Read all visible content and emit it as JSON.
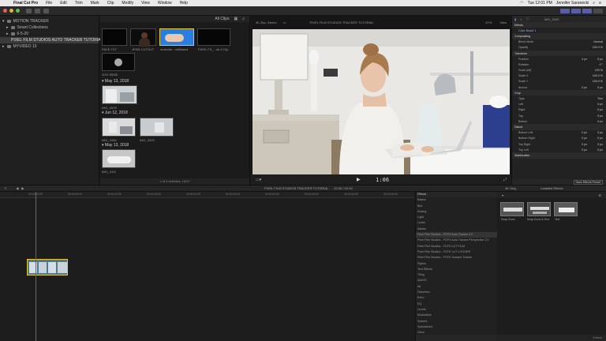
{
  "menubar": {
    "app_name": "Final Cut Pro",
    "menus": [
      "File",
      "Edit",
      "Trim",
      "Mark",
      "Clip",
      "Modify",
      "View",
      "Window",
      "Help"
    ],
    "day_time": "Tue 12:01 PM",
    "user": "Jennifer Saranecki"
  },
  "libraries": {
    "items": [
      {
        "label": "MOTION TRACKER",
        "level": 1
      },
      {
        "label": "Smart Collections",
        "level": 2
      },
      {
        "label": "6-5-20",
        "level": 2
      },
      {
        "label": "PIXEL FILM STUDIOS AUTO TRACKER TUTORIAL",
        "level": 2,
        "selected": true
      },
      {
        "label": "MYVIDEO 10",
        "level": 1
      }
    ]
  },
  "browser": {
    "filter": "All Clips",
    "dates": [
      "May 13, 2018",
      "Jun 12, 2018",
      "May 13, 2018"
    ],
    "clips": [
      {
        "label": "FACE TXT"
      },
      {
        "label": "JENN CUTOUT"
      },
      {
        "label": "motionbr...mkBased"
      },
      {
        "label": "PIXEL FS_...ial 4 Clip"
      },
      {
        "label": "3OH 3RDB"
      },
      {
        "label": "IMG_9209"
      },
      {
        "label": "IMG_3366"
      },
      {
        "label": "IMG_3329"
      },
      {
        "label": "IMG_3111"
      }
    ],
    "footer": "1 of 4 selected, 18:07"
  },
  "viewer": {
    "format": "4K 30p, Stereo",
    "title": "PIXEL FILM STUDIOS TRACKER TUTORIAL",
    "zoom": "57%",
    "view_label": "View",
    "timecode": "1:06"
  },
  "inspector": {
    "header": "IMG_3329",
    "clip_name": "Color Board 1",
    "sections": [
      {
        "name": "Effects",
        "rows": []
      },
      {
        "name": "Compositing",
        "rows": [
          {
            "label": "Blend Mode",
            "value": "Normal"
          },
          {
            "label": "Opacity",
            "value": "100.0 %"
          }
        ]
      },
      {
        "name": "Transform",
        "rows": [
          {
            "label": "Position",
            "x": "0 px",
            "y": "0 px"
          },
          {
            "label": "Rotation",
            "value": "0 °"
          },
          {
            "label": "Scale (All)",
            "value": "100 %"
          },
          {
            "label": "Scale X",
            "value": "100.0 %"
          },
          {
            "label": "Scale Y",
            "value": "100.0 %"
          },
          {
            "label": "Anchor",
            "x": "0 px",
            "y": "0 px"
          }
        ]
      },
      {
        "name": "Crop",
        "rows": [
          {
            "label": "Type",
            "value": "Trim"
          },
          {
            "label": "Left",
            "value": "0 px"
          },
          {
            "label": "Right",
            "value": "0 px"
          },
          {
            "label": "Top",
            "value": "0 px"
          },
          {
            "label": "Bottom",
            "value": "0 px"
          }
        ]
      },
      {
        "name": "Distort",
        "rows": [
          {
            "label": "Bottom Left",
            "x": "0 px",
            "y": "0 px"
          },
          {
            "label": "Bottom Right",
            "x": "0 px",
            "y": "0 px"
          },
          {
            "label": "Top Right",
            "x": "0 px",
            "y": "0 px"
          },
          {
            "label": "Top Left",
            "x": "0 px",
            "y": "0 px"
          }
        ]
      },
      {
        "name": "Stabilization",
        "rows": []
      }
    ],
    "save_preset": "Save Effects Preset"
  },
  "timeline_bar": {
    "project": "PIXEL FILM STUDIOS TRACKER TUTORIAL",
    "duration": "02:00 / 02:19",
    "effects_title": "Effects"
  },
  "timeline": {
    "ruler": [
      "00:00:00:00",
      "00:00:05:00",
      "00:00:10:00",
      "00:00:15:00",
      "00:00:20:00",
      "00:00:25:00",
      "00:00:30:00",
      "00:00:35:00",
      "00:00:40:00",
      "00:00:45:00",
      "00:00:50:00"
    ]
  },
  "effects_list": {
    "items": [
      "Effects",
      "Basics",
      "Blur",
      "Keying",
      "Light",
      "Looks",
      "Masks",
      "Pixel Film Studios - FCPX Auto Tracker 2.0",
      "Pixel Film Studios - FCPX Auto Tracker Perspective 2.0",
      "Pixel Film Studios - FCPX LUT FILM",
      "Pixel Film Studios - FCPX LUT LOGGER",
      "Pixel Film Studios - FCPX Surface Tracker",
      "Stylize",
      "Text Effects",
      "Tiling",
      "AUDIO",
      "All",
      "Distortion",
      "Echo",
      "EQ",
      "Levels",
      "Modulation",
      "Spaces",
      "Specialized",
      "Voice"
    ],
    "highlight_index": 7
  },
  "effects_browser": {
    "filter": "4K Only",
    "title": "Installed Effects",
    "items": [
      {
        "label": "Snap Zoom"
      },
      {
        "label": "Snap Zoom & Text"
      },
      {
        "label": "Text"
      }
    ],
    "footer": "3 items"
  },
  "colors": {
    "accent": "#595ca8",
    "playhead": "#d23b3b",
    "selection": "#e6c73a"
  }
}
